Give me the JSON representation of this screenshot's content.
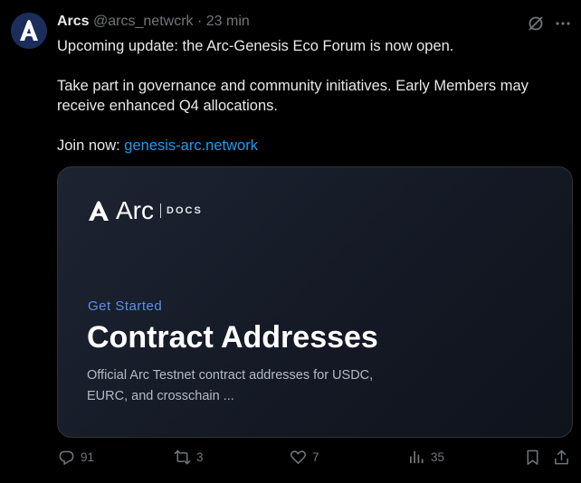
{
  "tweet": {
    "author_name": "Arcs",
    "handle": "@arcs_netwcrk",
    "separator": "·",
    "time": "23 min",
    "text_line1": "Upcoming update: the Arc-Genesis Eco Forum is now open.",
    "text_para2": "Take part in governance and community initiatives. Early Members may receive enhanced Q4 allocations.",
    "join_label": "Join now: ",
    "join_link": "genesis-arc.network"
  },
  "card": {
    "logo_text": "Arc",
    "logo_docs": "DOCS",
    "eyebrow": "Get Started",
    "title": "Contract Addresses",
    "description": "Official Arc Testnet contract addresses for USDC, EURC, and crosschain ..."
  },
  "actions": {
    "replies": "91",
    "reposts": "3",
    "likes": "7",
    "views": "35"
  },
  "colors": {
    "background": "#000000",
    "text": "#e7e9ea",
    "muted": "#71767b",
    "link": "#1d9bf0",
    "card_accent": "#5b8fe8"
  },
  "icons": [
    "grok-icon",
    "more-icon",
    "reply-icon",
    "repost-icon",
    "like-icon",
    "views-icon",
    "bookmark-icon",
    "share-icon"
  ]
}
